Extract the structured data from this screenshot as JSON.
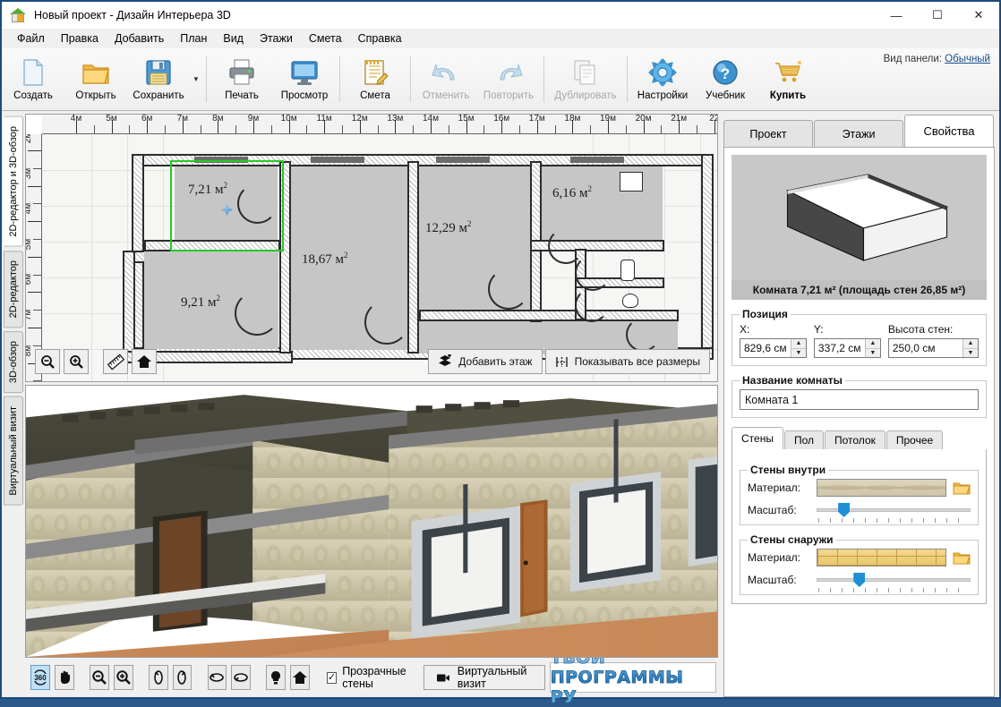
{
  "window": {
    "title": "Новый проект - Дизайн Интерьера 3D",
    "app_icon": "house-icon",
    "minimize": "—",
    "maximize": "☐",
    "close": "✕"
  },
  "menu": {
    "items": [
      "Файл",
      "Правка",
      "Добавить",
      "План",
      "Вид",
      "Этажи",
      "Смета",
      "Справка"
    ]
  },
  "toolbar": {
    "panel_view_label": "Вид панели:",
    "panel_view_value": "Обычный",
    "dropdown_caret": "▼",
    "groups": [
      {
        "buttons": [
          {
            "label": "Создать",
            "icon": "new-document-icon",
            "disabled": false,
            "bold": false
          },
          {
            "label": "Открыть",
            "icon": "open-folder-icon",
            "disabled": false,
            "bold": false
          },
          {
            "label": "Сохранить",
            "icon": "save-floppy-icon",
            "disabled": false,
            "bold": false
          }
        ]
      },
      {
        "buttons": [
          {
            "label": "Печать",
            "icon": "printer-icon",
            "disabled": false,
            "bold": false
          },
          {
            "label": "Просмотр",
            "icon": "monitor-icon",
            "disabled": false,
            "bold": false
          }
        ]
      },
      {
        "buttons": [
          {
            "label": "Смета",
            "icon": "estimate-notepad-icon",
            "disabled": false,
            "bold": false
          }
        ]
      },
      {
        "buttons": [
          {
            "label": "Отменить",
            "icon": "undo-arrow-icon",
            "disabled": true,
            "bold": false
          },
          {
            "label": "Повторить",
            "icon": "redo-arrow-icon",
            "disabled": true,
            "bold": false
          }
        ]
      },
      {
        "buttons": [
          {
            "label": "Дублировать",
            "icon": "duplicate-pages-icon",
            "disabled": true,
            "bold": false
          }
        ]
      },
      {
        "buttons": [
          {
            "label": "Настройки",
            "icon": "gear-icon",
            "disabled": false,
            "bold": false
          },
          {
            "label": "Учебник",
            "icon": "question-help-icon",
            "disabled": false,
            "bold": false
          },
          {
            "label": "Купить",
            "icon": "shopping-cart-icon",
            "disabled": false,
            "bold": true
          }
        ]
      }
    ]
  },
  "vertical_tabs": [
    {
      "label": "2D-редактор и 3D-обзор",
      "active": true
    },
    {
      "label": "2D-редактор",
      "active": false
    },
    {
      "label": "3D-обзор",
      "active": false
    },
    {
      "label": "Виртуальный визит",
      "active": false
    }
  ],
  "plan": {
    "ruler_h_labels": [
      "4м",
      "5м",
      "6м",
      "7м",
      "8м",
      "9м",
      "10м",
      "11м",
      "12м",
      "13м",
      "14м",
      "15м",
      "16м",
      "17м",
      "18м",
      "19м",
      "20м",
      "21м",
      "22"
    ],
    "ruler_v_labels": [
      "2м",
      "3м",
      "4м",
      "5м",
      "6м",
      "7м",
      "8м"
    ],
    "rooms": [
      {
        "area": "7,21 м",
        "sup": "2",
        "selected": true
      },
      {
        "area": "9,21 м",
        "sup": "2",
        "selected": false
      },
      {
        "area": "18,67 м",
        "sup": "2",
        "selected": false
      },
      {
        "area": "12,29 м",
        "sup": "2",
        "selected": false
      },
      {
        "area": "6,16 м",
        "sup": "2",
        "selected": false
      }
    ],
    "tools": [
      {
        "icon": "zoom-out-icon",
        "label": "−"
      },
      {
        "icon": "zoom-in-icon",
        "label": "+"
      },
      {
        "icon": "ruler-icon",
        "label": ""
      },
      {
        "icon": "home-icon",
        "label": ""
      }
    ],
    "add_floor_button": "Добавить этаж",
    "add_floor_icon": "add-floor-icon",
    "show_sizes_button": "Показывать все размеры",
    "show_sizes_icon": "dimensions-icon"
  },
  "bottom_toolbar": {
    "buttons": [
      {
        "icon": "orbit-360-icon",
        "glyph": "360",
        "active": true
      },
      {
        "icon": "pan-hand-icon",
        "glyph": "✋",
        "active": false
      },
      {
        "icon": "zoom-out-icon",
        "glyph": "−",
        "active": false
      },
      {
        "icon": "zoom-in-icon",
        "glyph": "+",
        "active": false
      },
      {
        "icon": "rotate-left-icon",
        "glyph": "↺",
        "active": false
      },
      {
        "icon": "rotate-right-icon",
        "glyph": "↻",
        "active": false
      },
      {
        "icon": "tilt-back-icon",
        "glyph": "⟲",
        "active": false
      },
      {
        "icon": "tilt-forward-icon",
        "glyph": "⟳",
        "active": false
      },
      {
        "icon": "lightbulb-icon",
        "glyph": "💡",
        "active": false
      },
      {
        "icon": "home-icon",
        "glyph": "⌂",
        "active": false
      }
    ],
    "transparent_walls_label": "Прозрачные стены",
    "transparent_walls_checked": true,
    "checkmark": "✓",
    "virtual_visit_label": "Виртуальный визит",
    "virtual_visit_icon": "video-camera-icon",
    "brand": "ТВОИ ПРОГРАММЫ РУ"
  },
  "right_panel": {
    "tabs": [
      {
        "label": "Проект",
        "active": false
      },
      {
        "label": "Этажи",
        "active": false
      },
      {
        "label": "Свойства",
        "active": true
      }
    ],
    "preview_caption": "Комната 7,21 м²  (площадь стен 26,85 м²)",
    "position": {
      "legend": "Позиция",
      "fields": [
        {
          "label": "X:",
          "value": "829,6 см"
        },
        {
          "label": "Y:",
          "value": "337,2 см"
        },
        {
          "label": "Высота стен:",
          "value": "250,0 см"
        }
      ],
      "up_arrow": "▲",
      "down_arrow": "▼"
    },
    "room_name": {
      "legend": "Название комнаты",
      "value": "Комната 1"
    },
    "surface_tabs": [
      {
        "label": "Стены",
        "active": true
      },
      {
        "label": "Пол",
        "active": false
      },
      {
        "label": "Потолок",
        "active": false
      },
      {
        "label": "Прочее",
        "active": false
      }
    ],
    "walls_inside": {
      "legend": "Стены внутри",
      "material_label": "Материал:",
      "material_swatch": "wallpaper-beige-texture",
      "browse_icon": "open-folder-icon",
      "scale_label": "Масштаб:",
      "scale_percent": 14
    },
    "walls_outside": {
      "legend": "Стены снаружи",
      "material_label": "Материал:",
      "material_swatch": "brick-yellow-texture",
      "browse_icon": "open-folder-icon",
      "scale_label": "Масштаб:",
      "scale_percent": 24
    }
  },
  "colors": {
    "accent": "#1f8fd6",
    "window_border": "#1c4a7c",
    "selection_green": "#28c828",
    "chrome_bg": "#f0f0f0"
  }
}
